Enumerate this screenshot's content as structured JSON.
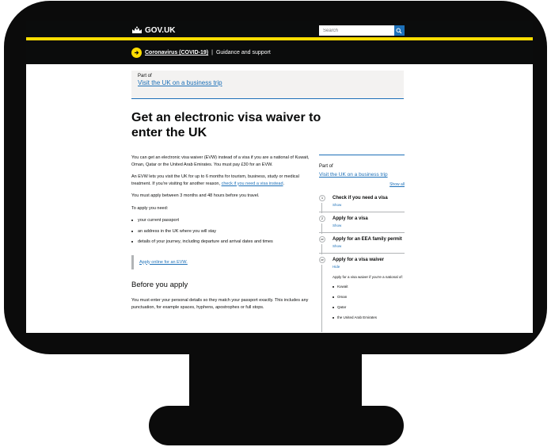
{
  "header": {
    "logo_text": "GOV.UK",
    "search_placeholder": "Search"
  },
  "covid_banner": {
    "link_text": "Coronavirus (COVID-19)",
    "separator": "|",
    "suffix": "Guidance and support"
  },
  "part_of": {
    "label": "Part of",
    "link": "Visit the UK on a business trip"
  },
  "page": {
    "title": "Get an electronic visa waiver to enter the UK",
    "intro": "You can get an electronic visa waiver (EVW) instead of a visa if you are a national of Kuwait, Oman, Qatar or the United Arab Emirates. You must pay £30 for an EVW.",
    "para2_prefix": "An EVW lets you visit the UK for up to 6 months for tourism, business, study or medical treatment. If you're visiting for another reason, ",
    "para2_link": "check if you need a visa instead",
    "para2_suffix": ".",
    "para3": "You must apply between 3 months and 48 hours before you travel.",
    "para4": "To apply you need:",
    "needs": [
      "your current passport",
      "an address in the UK where you will stay",
      "details of your journey, including departure and arrival dates and times"
    ],
    "apply_link": "Apply online for an EVW.",
    "section_heading": "Before you apply",
    "section_para": "You must enter your personal details so they match your passport exactly. This includes any punctuation, for example spaces, hyphens, apostrophes or full stops."
  },
  "sidebar": {
    "part_of_label": "Part of",
    "part_of_link": "Visit the UK on a business trip",
    "show_all": "Show all",
    "steps": [
      {
        "marker": "1",
        "title": "Check if you need a visa",
        "toggle": "Show"
      },
      {
        "marker": "2",
        "title": "Apply for a visa",
        "toggle": "Show"
      },
      {
        "marker": "or",
        "title": "Apply for an EEA family permit",
        "toggle": "Show"
      },
      {
        "marker": "or",
        "title": "Apply for a visa waiver",
        "toggle": "Hide"
      }
    ],
    "expanded_text": "Apply for a visa waiver if you're a national of:",
    "expanded_items": [
      "Kuwait",
      "Oman",
      "Qatar",
      "the United Arab Emirates"
    ]
  },
  "colors": {
    "header_bg": "#0b0c0c",
    "accent_yellow": "#ffdd00",
    "link_blue": "#1d70b8"
  }
}
